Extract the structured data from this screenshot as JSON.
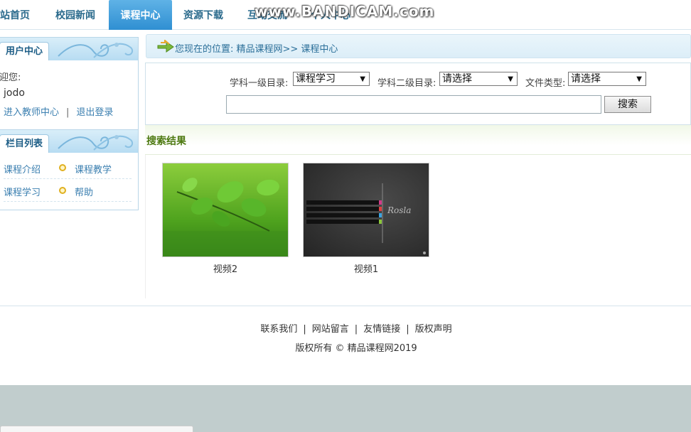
{
  "nav": {
    "items": [
      {
        "label": "站首页"
      },
      {
        "label": "校园新闻"
      },
      {
        "label": "课程中心",
        "active": true
      },
      {
        "label": "资源下载"
      },
      {
        "label": "互动交流"
      },
      {
        "label": "个人中心"
      }
    ]
  },
  "watermark": "www.BANDICAM.com",
  "user_panel": {
    "title": "用户中心",
    "welcome": "迎您:",
    "username": "jodo",
    "teacher_link": "进入教师中心",
    "separator": "|",
    "logout_link": "退出登录"
  },
  "menu_panel": {
    "title": "栏目列表",
    "items": [
      "课程介绍",
      "课程教学",
      "课程学习",
      "帮助"
    ]
  },
  "breadcrumb": {
    "text": "您现在的位置:  精品课程网>> 课程中心"
  },
  "search": {
    "level1_label": "学科一级目录:",
    "level1_value": "课程学习",
    "level2_label": "学科二级目录:",
    "level2_value": "请选择",
    "filetype_label": "文件类型:",
    "filetype_value": "请选择",
    "keyword_value": "",
    "button": "搜索"
  },
  "results": {
    "title": "搜索结果",
    "items": [
      {
        "caption": "视频2",
        "thumb": "green-leaves-photo"
      },
      {
        "caption": "视频1",
        "thumb": "dark-website-template"
      }
    ]
  },
  "footer": {
    "links": [
      "联系我们",
      "网站留言",
      "友情链接",
      "版权声明"
    ],
    "separator": "|",
    "copyright": "版权所有 © 精品课程网2019"
  },
  "colors": {
    "accent": "#2f8fd2",
    "link": "#3b7fb0",
    "results_title": "#4e7a12"
  }
}
